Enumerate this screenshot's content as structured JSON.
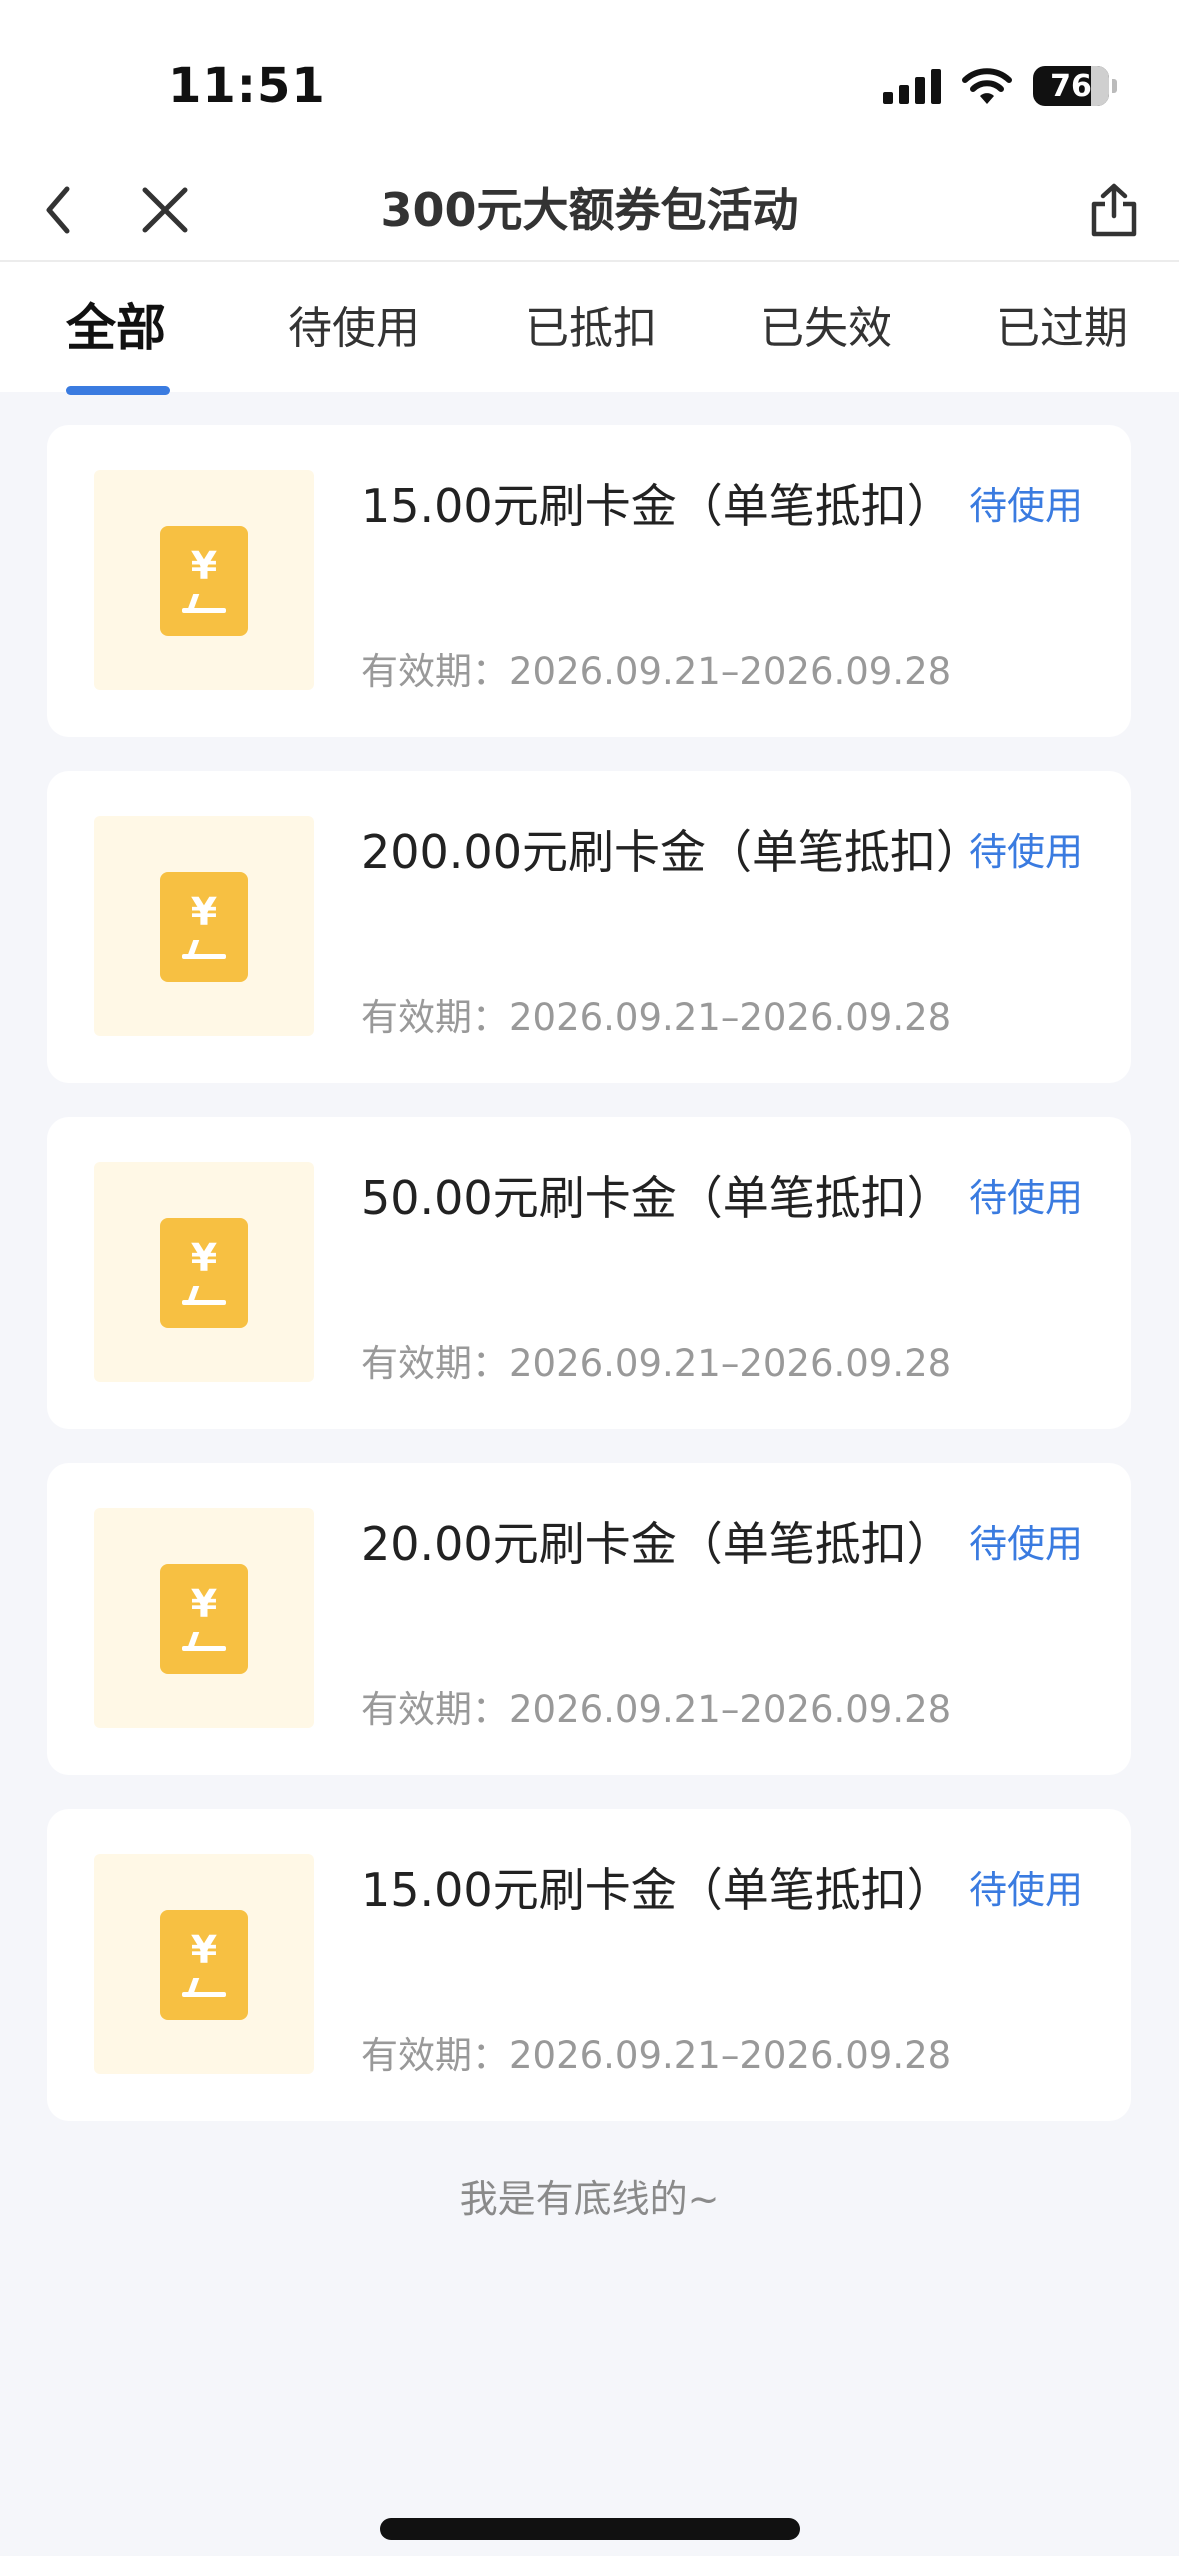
{
  "status_bar": {
    "time": "11:51",
    "battery": "76"
  },
  "header": {
    "title": "300元大额券包活动"
  },
  "tabs": [
    {
      "label": "全部",
      "active": true
    },
    {
      "label": "待使用",
      "active": false
    },
    {
      "label": "已抵扣",
      "active": false
    },
    {
      "label": "已失效",
      "active": false
    },
    {
      "label": "已过期",
      "active": false
    }
  ],
  "coupons": [
    {
      "title": "15.00元刷卡金（单笔抵扣）",
      "status": "待使用",
      "validity_label": "有效期：",
      "validity": "2026.09.21–2026.09.28"
    },
    {
      "title": "200.00元刷卡金（单笔抵扣）",
      "status": "待使用",
      "validity_label": "有效期：",
      "validity": "2026.09.21–2026.09.28"
    },
    {
      "title": "50.00元刷卡金（单笔抵扣）",
      "status": "待使用",
      "validity_label": "有效期：",
      "validity": "2026.09.21–2026.09.28"
    },
    {
      "title": "20.00元刷卡金（单笔抵扣）",
      "status": "待使用",
      "validity_label": "有效期：",
      "validity": "2026.09.21–2026.09.28"
    },
    {
      "title": "15.00元刷卡金（单笔抵扣）",
      "status": "待使用",
      "validity_label": "有效期：",
      "validity": "2026.09.21–2026.09.28"
    }
  ],
  "coupon_icon_symbol": "¥",
  "footer_note": "我是有底线的~",
  "colors": {
    "accent": "#3a7be0",
    "coupon_yellow": "#f7c042",
    "thumb_bg": "#fff8e6",
    "page_bg": "#f5f6fa"
  }
}
